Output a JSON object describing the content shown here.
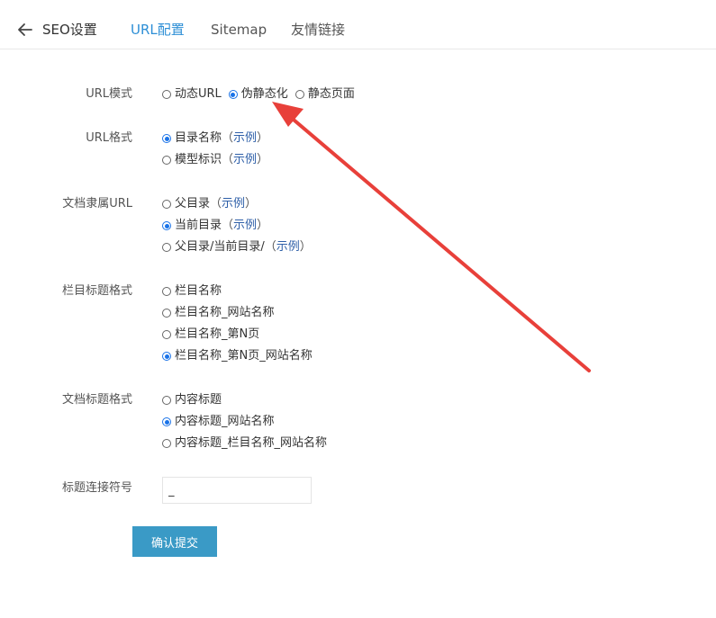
{
  "header": {
    "title": "SEO设置",
    "tabs": [
      "URL配置",
      "Sitemap",
      "友情链接"
    ],
    "active_tab": "URL配置"
  },
  "form": {
    "url_mode": {
      "label": "URL模式",
      "options": [
        "动态URL",
        "伪静态化",
        "静态页面"
      ],
      "selected": "伪静态化"
    },
    "url_format": {
      "label": "URL格式",
      "options": [
        {
          "text": "目录名称",
          "example": "示例"
        },
        {
          "text": "模型标识",
          "example": "示例"
        }
      ],
      "selected": "目录名称"
    },
    "doc_url": {
      "label": "文档隶属URL",
      "options": [
        {
          "text": "父目录",
          "example": "示例"
        },
        {
          "text": "当前目录",
          "example": "示例"
        },
        {
          "text": "父目录/当前目录/",
          "example": "示例"
        }
      ],
      "selected": "当前目录"
    },
    "column_title": {
      "label": "栏目标题格式",
      "options": [
        "栏目名称",
        "栏目名称_网站名称",
        "栏目名称_第N页",
        "栏目名称_第N页_网站名称"
      ],
      "selected": "栏目名称_第N页_网站名称"
    },
    "doc_title": {
      "label": "文档标题格式",
      "options": [
        "内容标题",
        "内容标题_网站名称",
        "内容标题_栏目名称_网站名称"
      ],
      "selected": "内容标题_网站名称"
    },
    "separator": {
      "label": "标题连接符号",
      "value": "_"
    },
    "submit_label": "确认提交"
  },
  "colors": {
    "accent": "#2e8fd6",
    "button": "#3a9ac6",
    "annotation_arrow": "#e8403a",
    "link": "#2e5fa8"
  }
}
